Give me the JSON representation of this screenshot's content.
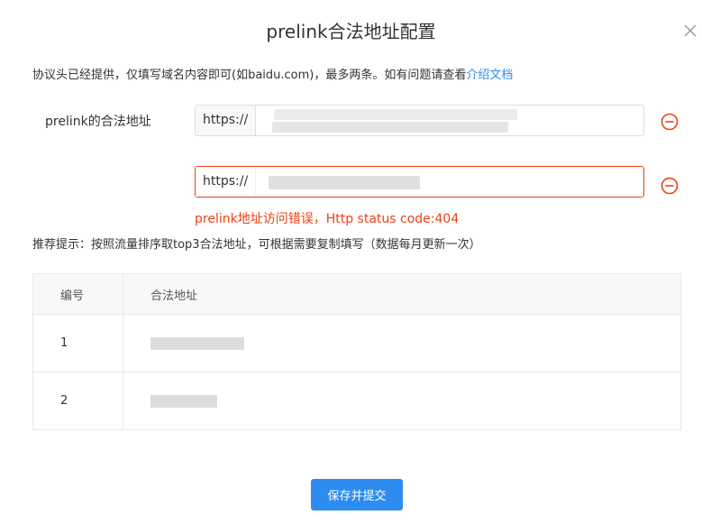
{
  "dialog": {
    "title": "prelink合法地址配置",
    "close_icon": "close-icon"
  },
  "hint": {
    "text": "协议头已经提供，仅填写域名内容即可(如baidu.com)，最多两条。如有问题请查看",
    "link_label": "介绍文档"
  },
  "form": {
    "field_label": "prelink的合法地址",
    "inputs": [
      {
        "prefix": "https://",
        "value": "",
        "state": "normal"
      },
      {
        "prefix": "https://",
        "value": "",
        "state": "error"
      }
    ],
    "remove_icon": "minus-circle-icon",
    "error_message": "prelink地址访问错误，Http status code:404"
  },
  "recommend": {
    "text": "推荐提示：按照流量排序取top3合法地址，可根据需要复制填写（数据每月更新一次）"
  },
  "table": {
    "headers": [
      "编号",
      "合法地址"
    ],
    "rows": [
      {
        "index": "1",
        "address": ""
      },
      {
        "index": "2",
        "address": ""
      }
    ]
  },
  "footer": {
    "submit_label": "保存并提交"
  },
  "colors": {
    "primary": "#2d8cf0",
    "error": "#ed4014",
    "border": "#dcdee2"
  }
}
